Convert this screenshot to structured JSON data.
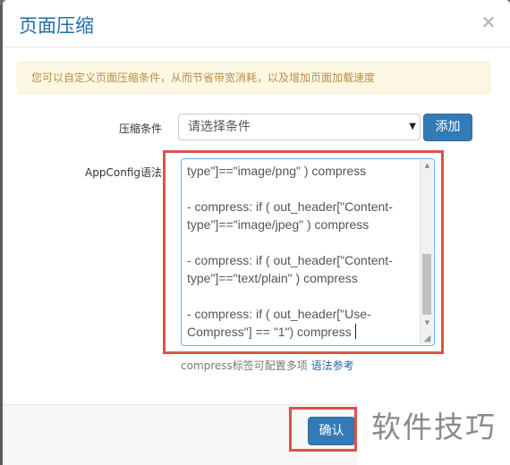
{
  "modal": {
    "title": "页面压缩",
    "close_label": "×"
  },
  "alert": {
    "text": "您可以自定义页面压缩条件，从而节省带宽消耗，以及增加页面加载速度"
  },
  "form": {
    "condition_label": "压缩条件",
    "condition_select_value": "请选择条件",
    "add_button": "添加",
    "appconfig_label": "AppConfig语法",
    "appconfig_lines": [
      "type\"]==\"image/png\" ) compress",
      "",
      " - compress: if ( out_header[\"Content-",
      "type\"]==\"image/jpeg\" ) compress",
      "",
      " - compress: if ( out_header[\"Content-",
      "type\"]==\"text/plain\" ) compress",
      "",
      " - compress: if ( out_header[\"Use-",
      "Compress\"] == \"1\") compress"
    ],
    "help_text": "compress标签可配置多项",
    "help_link": "语法参考"
  },
  "footer": {
    "confirm_button": "确认"
  },
  "watermark": {
    "text": "软件技巧"
  },
  "colors": {
    "primary": "#337ab7",
    "title": "#1f6fa8",
    "alert_bg": "#fcf8e3",
    "alert_text": "#b98e47",
    "highlight": "#d9534f"
  },
  "icons": {
    "close": "close-icon",
    "select_arrow": "chevron-down-icon",
    "scroll_up": "arrow-up-icon",
    "scroll_down": "arrow-down-icon",
    "resize": "resize-grip-icon"
  }
}
